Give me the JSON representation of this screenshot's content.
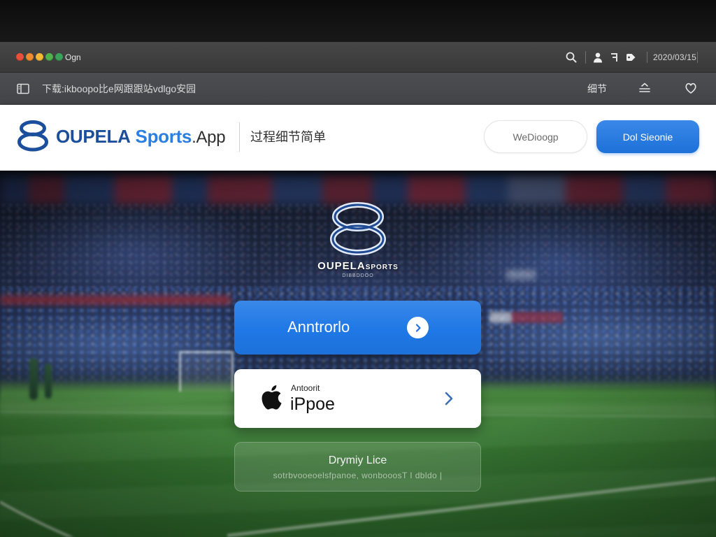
{
  "theme": {
    "accent": "#1f78e6",
    "brand_navy": "#1b4f9c",
    "brand_blue": "#2b7fe0"
  },
  "window": {
    "traffic_colors": [
      "#e9503b",
      "#ef8a2d",
      "#f3b935",
      "#4fb24b",
      "#3aa35b"
    ],
    "title": "Ogn",
    "date": "2020/03/15",
    "icons": [
      "search-icon",
      "person-icon",
      "flag-icon",
      "tag-icon"
    ]
  },
  "toolbar": {
    "address": "下载:ikboopo比e网跟跟站vdlgo安园",
    "details_label": "细节",
    "icons": [
      "sidebar-icon",
      "menu-icon",
      "heart-icon"
    ]
  },
  "header": {
    "brand_primary": "OUPELA",
    "brand_secondary": "Sports",
    "brand_suffix": ".App",
    "tagline": "过程细节简单",
    "secondary_button": "WeDioogp",
    "primary_button": "Dol Sieonie"
  },
  "hero": {
    "logo_name": "OUPELA",
    "logo_name_suffix": "sports",
    "logo_caption": "DIBBDDOO",
    "android_button": {
      "label": "Anntrorlo",
      "icon": "chevron-right-icon"
    },
    "ios_button": {
      "caption": "Antoorit",
      "label": "iPpoe",
      "icon": "apple-icon"
    },
    "third_button": {
      "title": "Drymiy Lice",
      "subtitle": "sotrbvooeoelsfpanoe, wonbooosT I dbldo |"
    }
  }
}
